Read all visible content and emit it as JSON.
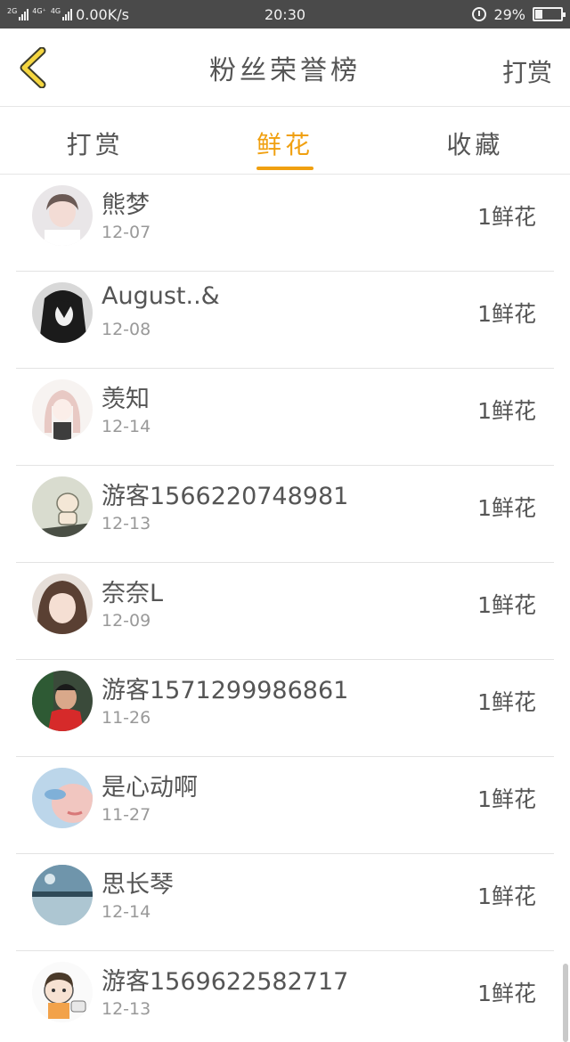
{
  "status_bar": {
    "net_2g": "2G",
    "net_4g_plus": "4G⁺",
    "net_4g": "4G",
    "speed": "0.00K/s",
    "time": "20:30",
    "battery_percent": "29%",
    "battery_level": 0.29
  },
  "nav": {
    "title": "粉丝荣誉榜",
    "action": "打赏",
    "back_icon": "chevron-left-icon"
  },
  "tabs": [
    {
      "label": "打赏",
      "active": false
    },
    {
      "label": "鲜花",
      "active": true
    },
    {
      "label": "收藏",
      "active": false
    }
  ],
  "accent_color": "#f0a010",
  "fans": [
    {
      "name": "熊梦",
      "date": "12-07",
      "gift": "1鲜花",
      "avatar": "girl-portrait-avatar"
    },
    {
      "name": "August..&",
      "date": "12-08",
      "gift": "1鲜花",
      "avatar": "anime-dark-avatar"
    },
    {
      "name": "羡知",
      "date": "12-14",
      "gift": "1鲜花",
      "avatar": "anime-girl-avatar"
    },
    {
      "name": "游客1566220748981",
      "date": "12-13",
      "gift": "1鲜花",
      "avatar": "cartoon-baby-avatar"
    },
    {
      "name": "奈奈L",
      "date": "12-09",
      "gift": "1鲜花",
      "avatar": "girl-photo-avatar"
    },
    {
      "name": "游客1571299986861",
      "date": "11-26",
      "gift": "1鲜花",
      "avatar": "boy-red-shirt-avatar"
    },
    {
      "name": "是心动啊",
      "date": "11-27",
      "gift": "1鲜花",
      "avatar": "blue-face-avatar"
    },
    {
      "name": "思长琴",
      "date": "12-14",
      "gift": "1鲜花",
      "avatar": "lake-landscape-avatar"
    },
    {
      "name": "游客1569622582717",
      "date": "12-13",
      "gift": "1鲜花",
      "avatar": "cartoon-boy-avatar"
    }
  ]
}
